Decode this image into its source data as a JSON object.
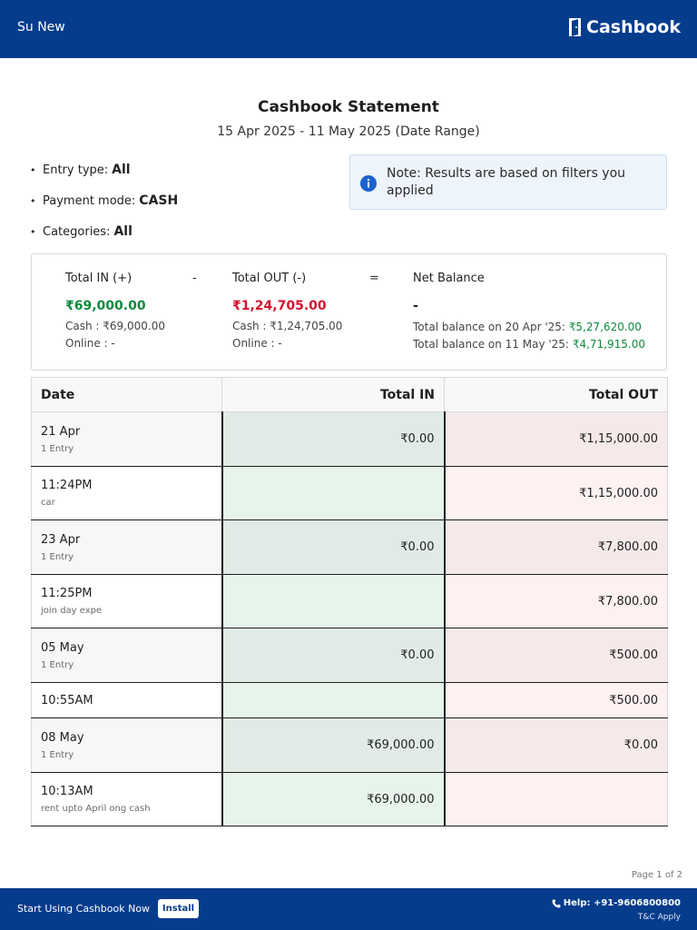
{
  "header": {
    "business_name": "Su New",
    "brand": "Cashbook"
  },
  "report": {
    "title": "Cashbook Statement",
    "date_range": "15 Apr 2025 - 11 May 2025 (Date Range)"
  },
  "filters": [
    {
      "label": "Entry type:",
      "value": "All"
    },
    {
      "label": "Payment mode:",
      "value": "CASH"
    },
    {
      "label": "Categories:",
      "value": "All"
    }
  ],
  "note": {
    "text": "Note: Results are based on filters you applied"
  },
  "summary": {
    "total_in": {
      "label": "Total IN (+)",
      "amount": "₹69,000.00",
      "cash": "Cash : ₹69,000.00",
      "online": "Online : -"
    },
    "op_minus": "-",
    "total_out": {
      "label": "Total OUT (-)",
      "amount": "₹1,24,705.00",
      "cash": "Cash : ₹1,24,705.00",
      "online": "Online : -"
    },
    "op_equals": "=",
    "net": {
      "label": "Net Balance",
      "amount": "-",
      "balance1_label": "Total balance on 20 Apr '25:",
      "balance1_value": "₹5,27,620.00",
      "balance2_label": "Total balance on 11 May '25:",
      "balance2_value": "₹4,71,915.00"
    }
  },
  "table": {
    "columns": [
      "Date",
      "Total IN",
      "Total OUT"
    ],
    "rows": [
      {
        "kind": "day",
        "main": "21 Apr",
        "sub": "1 Entry",
        "in": "₹0.00",
        "out": "₹1,15,000.00"
      },
      {
        "kind": "entry",
        "main": "11:24PM",
        "sub": "car",
        "in": "",
        "out": "₹1,15,000.00"
      },
      {
        "kind": "day",
        "main": "23 Apr",
        "sub": "1 Entry",
        "in": "₹0.00",
        "out": "₹7,800.00"
      },
      {
        "kind": "entry",
        "main": "11:25PM",
        "sub": "join day expe",
        "in": "",
        "out": "₹7,800.00"
      },
      {
        "kind": "day",
        "main": "05 May",
        "sub": "1 Entry",
        "in": "₹0.00",
        "out": "₹500.00"
      },
      {
        "kind": "entry",
        "main": "10:55AM",
        "sub": "",
        "in": "",
        "out": "₹500.00"
      },
      {
        "kind": "day",
        "main": "08 May",
        "sub": "1 Entry",
        "in": "₹69,000.00",
        "out": "₹0.00"
      },
      {
        "kind": "entry",
        "main": "10:13AM",
        "sub": "rent upto April ong cash",
        "in": "₹69,000.00",
        "out": ""
      }
    ]
  },
  "pagination": "Page 1 of 2",
  "footer": {
    "cta": "Start Using Cashbook Now",
    "install": "Install",
    "help": "Help: +91-9606800800",
    "tnc": "T&C Apply"
  }
}
